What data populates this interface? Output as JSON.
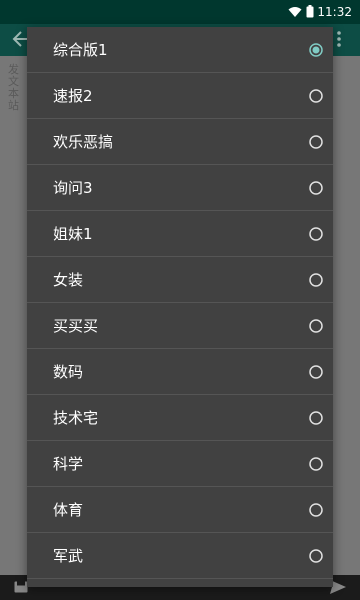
{
  "status_bar": {
    "time": "11:32",
    "icons": [
      "wifi-icon",
      "battery-icon"
    ]
  },
  "toolbar": {
    "back_icon": "arrow-back-icon",
    "more_icon": "more-vert-icon"
  },
  "background": {
    "text_lines": [
      "发文",
      "本站"
    ]
  },
  "bottom_bar": {
    "left_icon": "save-icon",
    "right_icon": "send-icon"
  },
  "dialog": {
    "selected": "综合版1",
    "options": [
      {
        "label": "综合版1",
        "selected": true
      },
      {
        "label": "速报2",
        "selected": false
      },
      {
        "label": "欢乐恶搞",
        "selected": false
      },
      {
        "label": "询问3",
        "selected": false
      },
      {
        "label": "姐妹1",
        "selected": false
      },
      {
        "label": "女装",
        "selected": false
      },
      {
        "label": "买买买",
        "selected": false
      },
      {
        "label": "数码",
        "selected": false
      },
      {
        "label": "技术宅",
        "selected": false
      },
      {
        "label": "科学",
        "selected": false
      },
      {
        "label": "体育",
        "selected": false
      },
      {
        "label": "军武",
        "selected": false
      }
    ]
  },
  "colors": {
    "status_bar": "#00372e",
    "toolbar": "#0d4d45",
    "dialog_bg": "#414141",
    "radio_selected": "#80cbc4",
    "radio_unselected": "#e0e0e0"
  }
}
